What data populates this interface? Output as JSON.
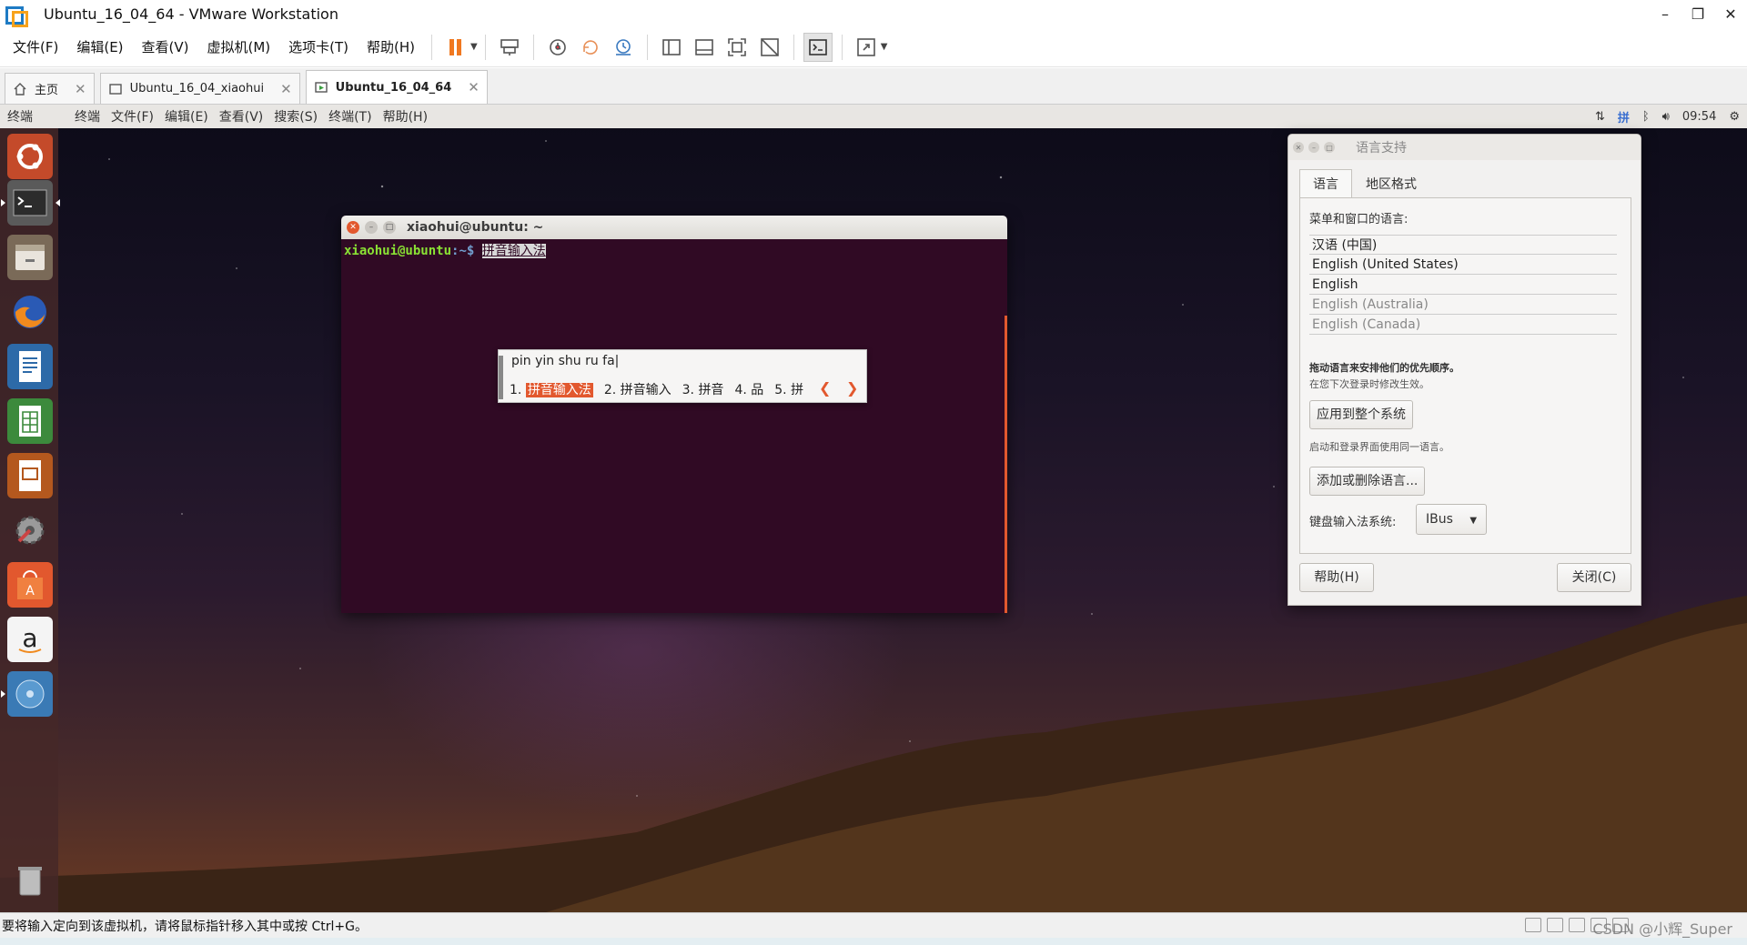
{
  "window": {
    "title": "Ubuntu_16_04_64 - VMware Workstation"
  },
  "menubar": {
    "items": [
      "文件(F)",
      "编辑(E)",
      "查看(V)",
      "虚拟机(M)",
      "选项卡(T)",
      "帮助(H)"
    ]
  },
  "tabs": [
    {
      "label": "主页",
      "icon": "home-icon",
      "active": false
    },
    {
      "label": "Ubuntu_16_04_xiaohui",
      "icon": "vm-icon",
      "active": false
    },
    {
      "label": "Ubuntu_16_04_64",
      "icon": "vm-running-icon",
      "active": true
    }
  ],
  "ubuntu_panel": {
    "app_name": "终端",
    "menus": [
      "终端",
      "文件(F)",
      "编辑(E)",
      "查看(V)",
      "搜索(S)",
      "终端(T)",
      "帮助(H)"
    ],
    "clock": "09:54"
  },
  "launcher": {
    "items": [
      "dash-icon",
      "terminal-icon",
      "files-icon",
      "firefox-icon",
      "writer-icon",
      "calc-icon",
      "impress-icon",
      "settings-icon",
      "software-center-icon",
      "amazon-icon",
      "disk-icon",
      "trash-icon"
    ]
  },
  "terminal": {
    "title": "xiaohui@ubuntu: ~",
    "prompt_user": "xiaohui@ubuntu",
    "prompt_path": ":~$ ",
    "preedit": "拼音输入法"
  },
  "ime": {
    "input": "pin yin shu ru fa|",
    "candidates": [
      {
        "index": "1.",
        "text": "拼音输入法",
        "selected": true
      },
      {
        "index": "2.",
        "text": "拼音输入",
        "selected": false
      },
      {
        "index": "3.",
        "text": "拼音",
        "selected": false
      },
      {
        "index": "4.",
        "text": "品",
        "selected": false
      },
      {
        "index": "5.",
        "text": "拼",
        "selected": false
      }
    ],
    "prev": "❮",
    "next": "❯"
  },
  "language_dialog": {
    "title": "语言支持",
    "tabs": [
      "语言",
      "地区格式"
    ],
    "menu_lang_label": "菜单和窗口的语言:",
    "languages": [
      {
        "name": "汉语 (中国)",
        "grey": false
      },
      {
        "name": "English (United States)",
        "grey": false
      },
      {
        "name": "English",
        "grey": false
      },
      {
        "name": "English (Australia)",
        "grey": true
      },
      {
        "name": "English (Canada)",
        "grey": true
      }
    ],
    "drag_hint": "拖动语言来安排他们的优先顺序。",
    "next_login_hint": "在您下次登录时修改生效。",
    "apply_system": "应用到整个系统",
    "apply_hint": "启动和登录界面使用同一语言。",
    "add_remove": "添加或删除语言...",
    "keyboard_label": "键盘输入法系统:",
    "keyboard_value": "IBus",
    "help": "帮助(H)",
    "close": "关闭(C)"
  },
  "statusbar": {
    "hint": "要将输入定向到该虚拟机，请将鼠标指针移入其中或按 Ctrl+G。",
    "watermark": "CSDN @小辉_Super"
  },
  "colors": {
    "ubuntu_orange": "#e2582e",
    "terminal_bg": "#300a24",
    "prompt_green": "#8ae234",
    "prompt_blue": "#729fcf"
  }
}
